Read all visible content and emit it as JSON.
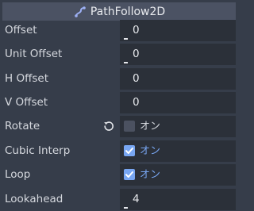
{
  "header": {
    "title": "PathFollow2D",
    "icon": "path-follow-icon",
    "accent": "#8ea5f2"
  },
  "properties": [
    {
      "label": "Offset",
      "value": "0",
      "kind": "slider"
    },
    {
      "label": "Unit Offset",
      "value": "0",
      "kind": "slider"
    },
    {
      "label": "H Offset",
      "value": "0",
      "kind": "number"
    },
    {
      "label": "V Offset",
      "value": "0",
      "kind": "number"
    },
    {
      "label": "Rotate",
      "checked": false,
      "check_text": "オン",
      "revert_icon": "revert-icon"
    },
    {
      "label": "Cubic Interp",
      "checked": true,
      "check_text": "オン"
    },
    {
      "label": "Loop",
      "checked": true,
      "check_text": "オン"
    },
    {
      "label": "Lookahead",
      "value": "4",
      "kind": "slider"
    }
  ],
  "colors": {
    "background": "#363d4a",
    "field": "#2b3039",
    "checked_accent": "#78a6f2"
  }
}
